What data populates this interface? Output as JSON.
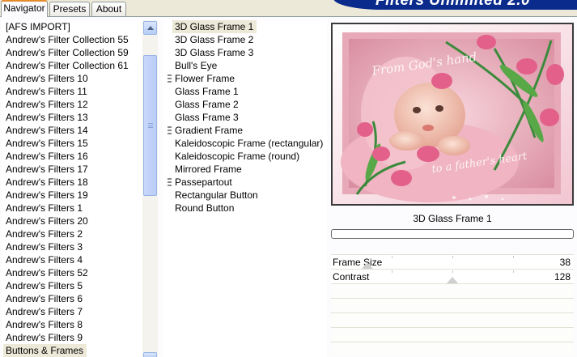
{
  "tabs": [
    {
      "label": "Navigator",
      "active": true
    },
    {
      "label": "Presets",
      "active": false
    },
    {
      "label": "About",
      "active": false
    }
  ],
  "brand": {
    "text": "Filters Unlimited 2.0"
  },
  "categories": {
    "items": [
      "[AFS IMPORT]",
      "Andrew's Filter Collection 55",
      "Andrew's Filter Collection 59",
      "Andrew's Filter Collection 61",
      "Andrew's Filters 10",
      "Andrew's Filters 11",
      "Andrew's Filters 12",
      "Andrew's Filters 13",
      "Andrew's Filters 14",
      "Andrew's Filters 15",
      "Andrew's Filters 16",
      "Andrew's Filters 17",
      "Andrew's Filters 18",
      "Andrew's Filters 19",
      "Andrew's Filters 1",
      "Andrew's Filters 20",
      "Andrew's Filters 2",
      "Andrew's Filters 3",
      "Andrew's Filters 4",
      "Andrew's Filters 52",
      "Andrew's Filters 5",
      "Andrew's Filters 6",
      "Andrew's Filters 7",
      "Andrew's Filters 8",
      "Andrew's Filters 9",
      "Buttons & Frames"
    ],
    "selected_index": 25
  },
  "filters": {
    "items": [
      {
        "label": "3D Glass Frame 1",
        "group": false
      },
      {
        "label": "3D Glass Frame 2",
        "group": false
      },
      {
        "label": "3D Glass Frame 3",
        "group": false
      },
      {
        "label": "Bull's Eye",
        "group": false
      },
      {
        "label": "Flower Frame",
        "group": true
      },
      {
        "label": "Glass Frame 1",
        "group": false
      },
      {
        "label": "Glass Frame 2",
        "group": false
      },
      {
        "label": "Glass Frame 3",
        "group": false
      },
      {
        "label": "Gradient Frame",
        "group": true
      },
      {
        "label": "Kaleidoscopic Frame (rectangular)",
        "group": false
      },
      {
        "label": "Kaleidoscopic Frame (round)",
        "group": false
      },
      {
        "label": "Mirrored Frame",
        "group": false
      },
      {
        "label": "Passepartout",
        "group": true
      },
      {
        "label": "Rectangular Button",
        "group": false
      },
      {
        "label": "Round Button",
        "group": false
      }
    ],
    "selected_index": 0
  },
  "preview": {
    "caption_top": "From God's hand",
    "caption_bottom": "to a father's heart"
  },
  "selected_filter": {
    "name": "3D Glass Frame 1"
  },
  "progress": {
    "value": 0.0
  },
  "params": [
    {
      "label": "Frame Size",
      "value": "38",
      "level": 0.15
    },
    {
      "label": "Contrast",
      "value": "128",
      "level": 0.5
    }
  ],
  "colors": {
    "panel_bg": "#ece9d8",
    "list_bg": "#ffffff",
    "selection": "#ece9d8",
    "brand": "#0a2a8c",
    "tab_accent": "#e68b2c"
  }
}
